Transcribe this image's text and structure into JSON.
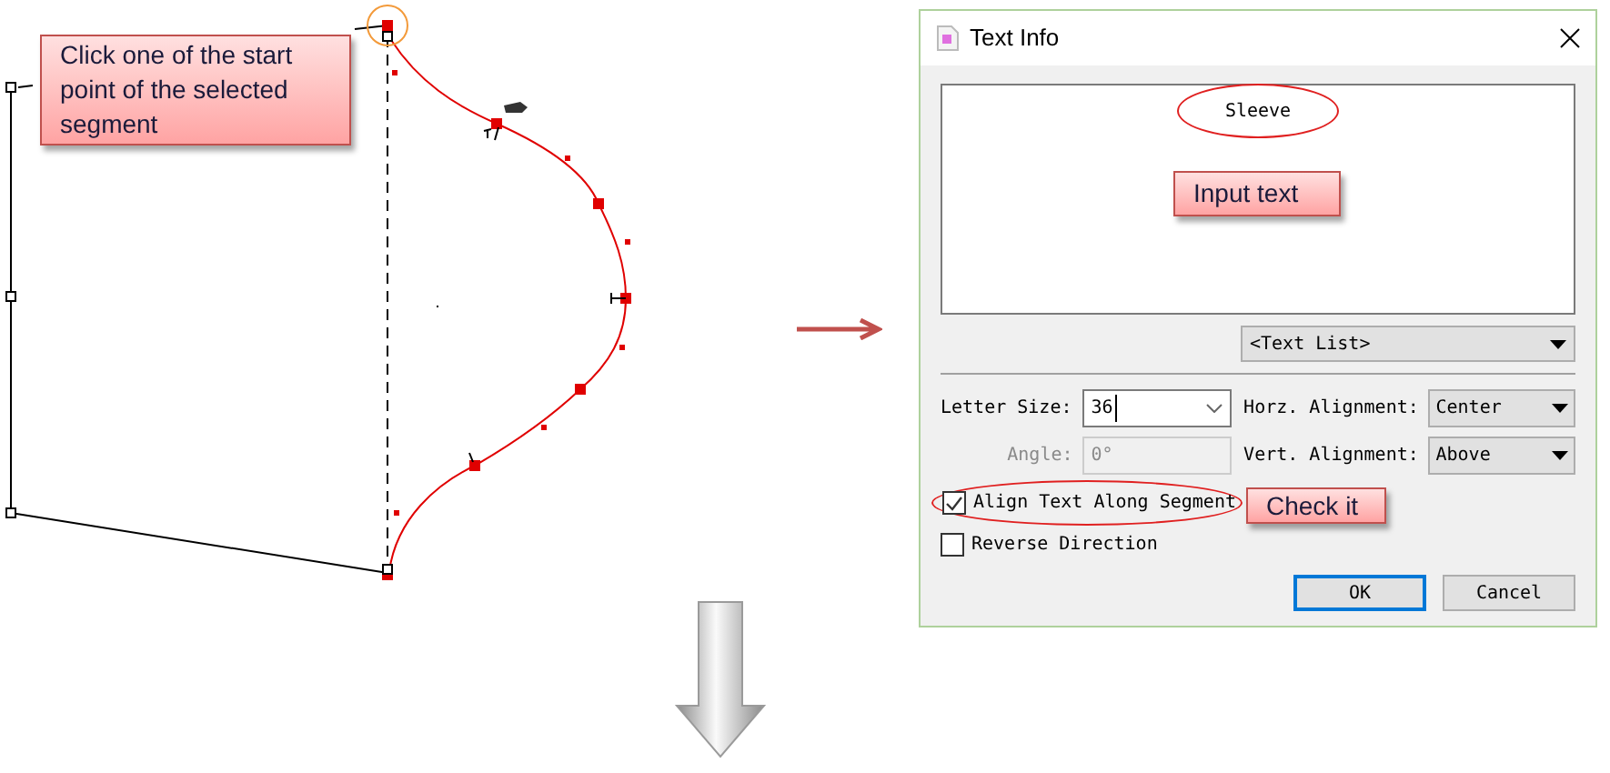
{
  "annotation": {
    "text": "Click one of the start point of the selected segment"
  },
  "dialog": {
    "title": "Text Info",
    "text_value": "Sleeve",
    "text_list": "<Text List>",
    "letter_size": {
      "label": "Letter Size:",
      "value": "36"
    },
    "horz_alignment": {
      "label": "Horz. Alignment:",
      "value": "Center"
    },
    "angle": {
      "label": "Angle:",
      "value": "0°",
      "disabled": true
    },
    "vert_alignment": {
      "label": "Vert. Alignment:",
      "value": "Above"
    },
    "checkboxes": [
      {
        "label": "Align Text Along Segment",
        "checked": true,
        "highlighted": true
      },
      {
        "label": "Reverse Direction",
        "checked": false,
        "highlighted": false
      }
    ],
    "buttons": [
      {
        "label": "OK",
        "default": true
      },
      {
        "label": "Cancel",
        "default": false
      }
    ]
  },
  "callouts": [
    {
      "text": "Input text"
    },
    {
      "text": "Check it"
    }
  ]
}
